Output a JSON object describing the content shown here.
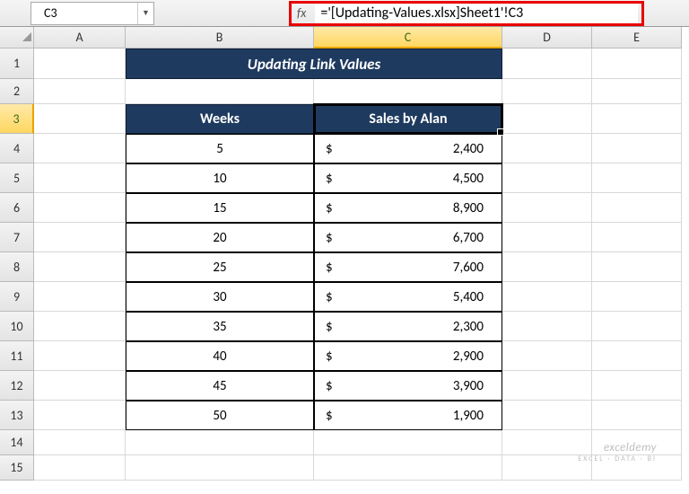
{
  "name_box": "C3",
  "fx_label": "fx",
  "formula": "='[Updating-Values.xlsx]Sheet1'!C3",
  "columns": [
    "A",
    "B",
    "C",
    "D",
    "E"
  ],
  "rows": [
    "1",
    "2",
    "3",
    "4",
    "5",
    "6",
    "7",
    "8",
    "9",
    "10",
    "11",
    "12",
    "13",
    "14",
    "15"
  ],
  "title": "Updating Link Values",
  "headers": {
    "b": "Weeks",
    "c": "Sales by Alan"
  },
  "currency": "$",
  "data": [
    {
      "week": "5",
      "sales": "2,400"
    },
    {
      "week": "10",
      "sales": "4,500"
    },
    {
      "week": "15",
      "sales": "8,900"
    },
    {
      "week": "20",
      "sales": "6,700"
    },
    {
      "week": "25",
      "sales": "7,600"
    },
    {
      "week": "30",
      "sales": "5,400"
    },
    {
      "week": "35",
      "sales": "2,300"
    },
    {
      "week": "40",
      "sales": "2,900"
    },
    {
      "week": "45",
      "sales": "3,900"
    },
    {
      "week": "50",
      "sales": "1,900"
    }
  ],
  "watermark": {
    "main": "exceldemy",
    "sub": "EXCEL · DATA · BI"
  },
  "chart_data": {
    "type": "table",
    "title": "Updating Link Values",
    "columns": [
      "Weeks",
      "Sales by Alan"
    ],
    "rows": [
      [
        5,
        2400
      ],
      [
        10,
        4500
      ],
      [
        15,
        8900
      ],
      [
        20,
        6700
      ],
      [
        25,
        7600
      ],
      [
        30,
        5400
      ],
      [
        35,
        2300
      ],
      [
        40,
        2900
      ],
      [
        45,
        3900
      ],
      [
        50,
        1900
      ]
    ]
  }
}
